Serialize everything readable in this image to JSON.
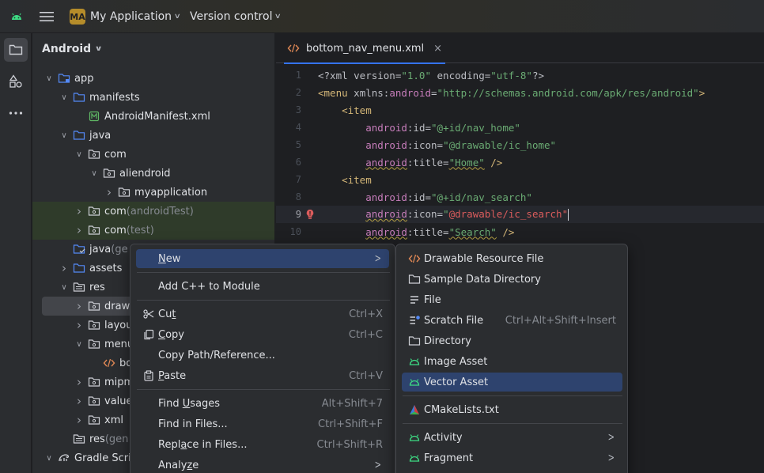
{
  "titlebar": {
    "project_badge": "MA",
    "project_name": "My Application",
    "vcs_label": "Version control"
  },
  "project_panel": {
    "view_label": "Android",
    "tree": [
      {
        "label": "app",
        "suffix": "",
        "icon": "module-folder-icon",
        "arrow": "down",
        "indent": 0
      },
      {
        "label": "manifests",
        "suffix": "",
        "icon": "folder-icon",
        "arrow": "down",
        "indent": 1
      },
      {
        "label": "AndroidManifest.xml",
        "suffix": "",
        "icon": "manifest-file-icon",
        "arrow": "none",
        "indent": 2
      },
      {
        "label": "java",
        "suffix": "",
        "icon": "folder-icon",
        "arrow": "down",
        "indent": 1
      },
      {
        "label": "com",
        "suffix": "",
        "icon": "package-icon",
        "arrow": "down",
        "indent": 2
      },
      {
        "label": "aliendroid",
        "suffix": "",
        "icon": "package-icon",
        "arrow": "down",
        "indent": 3
      },
      {
        "label": "myapplication",
        "suffix": "",
        "icon": "package-icon",
        "arrow": "right",
        "indent": 4
      },
      {
        "label": "com",
        "suffix": " (androidTest)",
        "icon": "package-icon",
        "arrow": "right",
        "indent": 2,
        "tint": "green"
      },
      {
        "label": "com",
        "suffix": " (test)",
        "icon": "package-icon",
        "arrow": "right",
        "indent": 2,
        "tint": "green"
      },
      {
        "label": "java",
        "suffix": " (ge",
        "icon": "generated-folder-icon",
        "arrow": "none",
        "indent": 1
      },
      {
        "label": "assets",
        "suffix": "",
        "icon": "folder-icon",
        "arrow": "right",
        "indent": 1
      },
      {
        "label": "res",
        "suffix": "",
        "icon": "res-folder-icon",
        "arrow": "down",
        "indent": 1
      },
      {
        "label": "drawa",
        "suffix": "",
        "icon": "package-icon",
        "arrow": "right",
        "indent": 2,
        "tint": "selected"
      },
      {
        "label": "layou",
        "suffix": "",
        "icon": "package-icon",
        "arrow": "right",
        "indent": 2
      },
      {
        "label": "menu",
        "suffix": "",
        "icon": "package-icon",
        "arrow": "down",
        "indent": 2
      },
      {
        "label": "bo",
        "suffix": "",
        "icon": "xml-file-icon",
        "arrow": "none",
        "indent": 3
      },
      {
        "label": "mipm",
        "suffix": "",
        "icon": "package-icon",
        "arrow": "right",
        "indent": 2
      },
      {
        "label": "value",
        "suffix": "",
        "icon": "package-icon",
        "arrow": "right",
        "indent": 2
      },
      {
        "label": "xml",
        "suffix": "",
        "icon": "package-icon",
        "arrow": "right",
        "indent": 2
      },
      {
        "label": "res",
        "suffix": " (gen",
        "icon": "res-folder-icon",
        "arrow": "none",
        "indent": 1
      },
      {
        "label": "Gradle Scrip",
        "suffix": "",
        "icon": "gradle-icon",
        "arrow": "down",
        "indent": 0
      }
    ]
  },
  "editor": {
    "tab_label": "bottom_nav_menu.xml",
    "tab_close": "×",
    "lines": [
      {
        "n": "1"
      },
      {
        "n": "2"
      },
      {
        "n": "3"
      },
      {
        "n": "4"
      },
      {
        "n": "5"
      },
      {
        "n": "6"
      },
      {
        "n": "7"
      },
      {
        "n": "8"
      },
      {
        "n": "9"
      },
      {
        "n": "10"
      }
    ],
    "code": {
      "l1_a": "<?xml version=",
      "l1_b": "\"1.0\"",
      "l1_c": " encoding=",
      "l1_d": "\"utf-8\"",
      "l1_e": "?>",
      "l2_tag": "<menu",
      "l2_ns": " xmlns:",
      "l2_attr": "android",
      "l2_eq": "=",
      "l2_val": "\"http://schemas.android.com/apk/res/android\"",
      "l2_end": ">",
      "item_tag": "<item",
      "android": "android",
      "l4_attr": ":id=",
      "l4_val": "\"@+id/nav_home\"",
      "l5_attr": ":icon=",
      "l5_val": "\"@drawable/ic_home\"",
      "l6_attr": ":title=",
      "l6_val": "\"Home\"",
      "l6_end": " />",
      "l8_attr": ":id=",
      "l8_val": "\"@+id/nav_search\"",
      "l9_attr": ":icon=",
      "l9_q": "\"",
      "l9_val": "@drawable/ic_search\"",
      "l10_attr": ":title=",
      "l10_val": "\"Search\"",
      "l10_end": " />"
    }
  },
  "context_menu": {
    "items": [
      {
        "label_u": "N",
        "label_rest": "ew",
        "shortcut": "",
        "submenu": true,
        "icon": ""
      },
      {
        "label": "Add C++ to Module",
        "shortcut": "",
        "icon": ""
      },
      {
        "label_pre": "Cu",
        "label_u": "t",
        "label_rest": "",
        "shortcut": "Ctrl+X",
        "icon": "scissors-icon"
      },
      {
        "label_u": "C",
        "label_rest": "opy",
        "shortcut": "Ctrl+C",
        "icon": "copy-icon"
      },
      {
        "label": "Copy Path/Reference...",
        "shortcut": "",
        "icon": ""
      },
      {
        "label_u": "P",
        "label_rest": "aste",
        "shortcut": "Ctrl+V",
        "icon": "paste-icon"
      },
      {
        "label_pre": "Find ",
        "label_u": "U",
        "label_rest": "sages",
        "shortcut": "Alt+Shift+7",
        "icon": ""
      },
      {
        "label": "Find in Files...",
        "shortcut": "Ctrl+Shift+F",
        "icon": ""
      },
      {
        "label_pre": "Repl",
        "label_u": "a",
        "label_rest": "ce in Files...",
        "shortcut": "Ctrl+Shift+R",
        "icon": ""
      },
      {
        "label_pre": "Analy",
        "label_u": "z",
        "label_rest": "e",
        "shortcut": "",
        "submenu": true,
        "icon": ""
      }
    ]
  },
  "new_submenu": {
    "items": [
      {
        "label": "Drawable Resource File",
        "shortcut": "",
        "icon": "xml-file-icon"
      },
      {
        "label": "Sample Data Directory",
        "shortcut": "",
        "icon": "folder-icon"
      },
      {
        "label": "File",
        "shortcut": "",
        "icon": "file-icon"
      },
      {
        "label": "Scratch File",
        "shortcut": "Ctrl+Alt+Shift+Insert",
        "icon": "scratch-file-icon"
      },
      {
        "label": "Directory",
        "shortcut": "",
        "icon": "folder-icon"
      },
      {
        "label": "Image Asset",
        "shortcut": "",
        "icon": "android-icon"
      },
      {
        "label": "Vector Asset",
        "shortcut": "",
        "icon": "android-icon"
      },
      {
        "label": "CMakeLists.txt",
        "shortcut": "",
        "icon": "cmake-icon"
      },
      {
        "label": "Activity",
        "shortcut": "",
        "submenu": true,
        "icon": "android-icon"
      },
      {
        "label": "Fragment",
        "shortcut": "",
        "submenu": true,
        "icon": "android-icon"
      }
    ]
  },
  "colors": {
    "accent": "#3574f0",
    "menu_highlight": "#2e436e",
    "xml_string": "#6aab73",
    "xml_tag": "#d5b778",
    "xml_namespace": "#c77dbb",
    "error": "#db5c5c"
  }
}
